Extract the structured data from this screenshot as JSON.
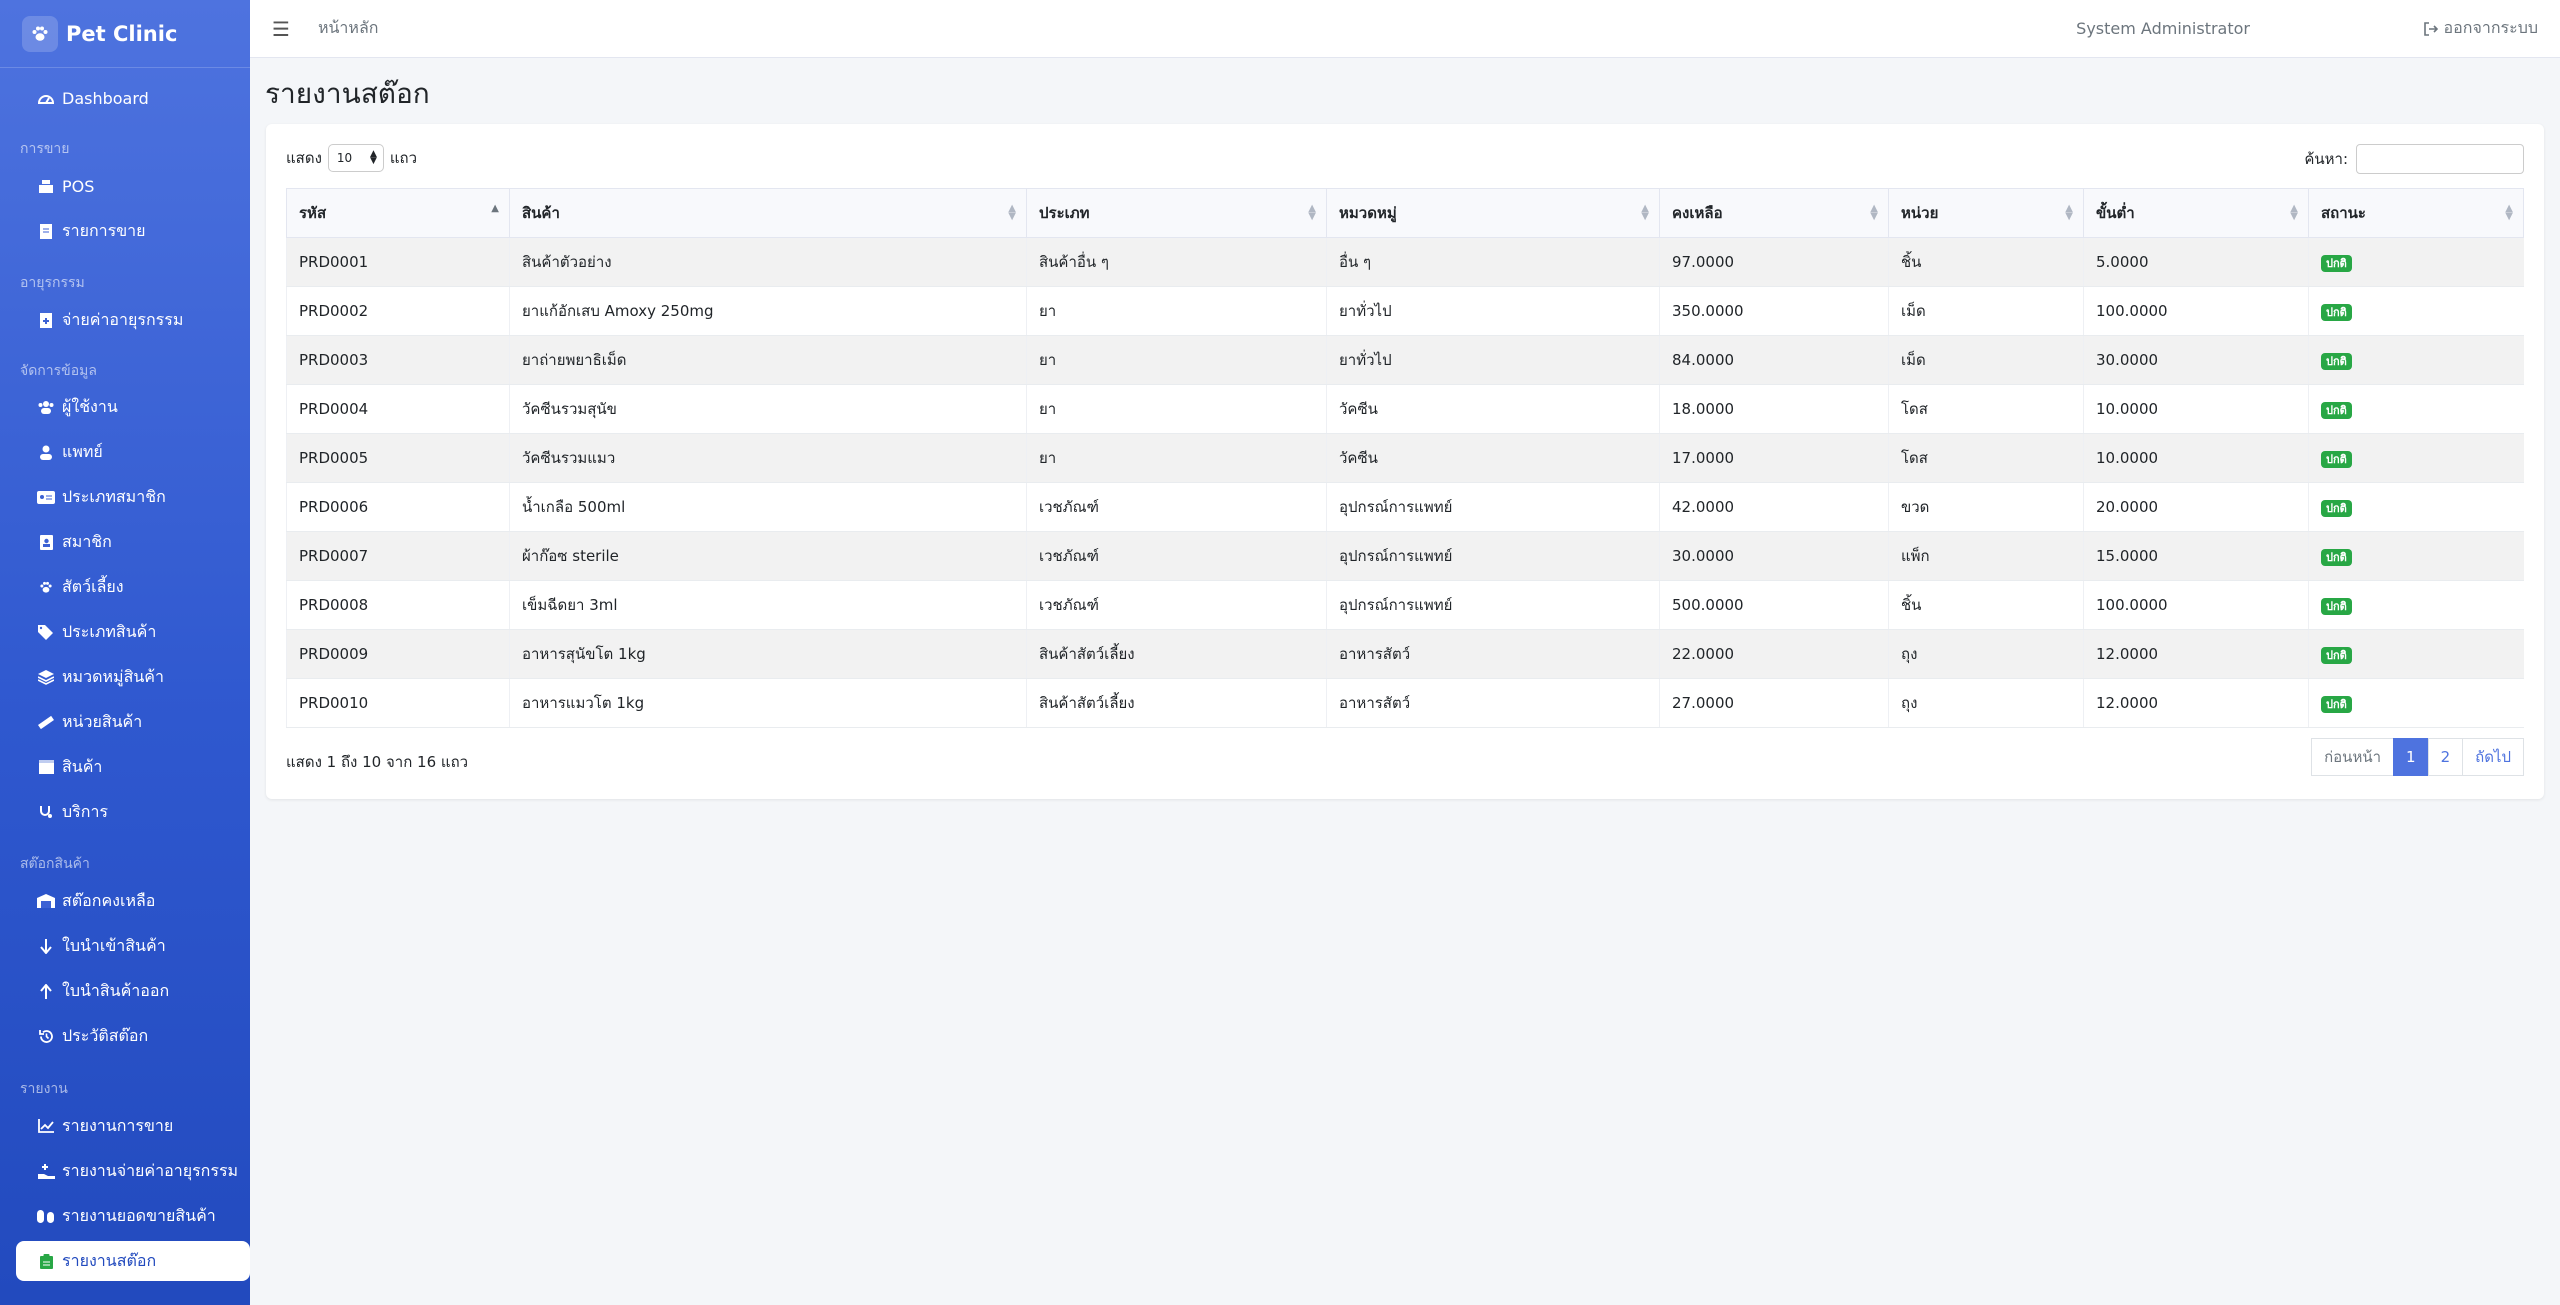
{
  "brand": {
    "name": "Pet Clinic"
  },
  "topbar": {
    "home_label": "หน้าหลัก",
    "user": "System Administrator",
    "logout_label": "ออกจากระบบ"
  },
  "sidebar": {
    "groups": [
      "การขาย",
      "อายุรกรรม",
      "จัดการข้อมูล",
      "สต๊อกสินค้า",
      "รายงาน"
    ],
    "items": [
      {
        "label": "Dashboard",
        "icon": "dashboard-icon"
      },
      {
        "label": "POS",
        "icon": "cash-register-icon"
      },
      {
        "label": "รายการขาย",
        "icon": "receipt-icon"
      },
      {
        "label": "จ่ายค่าอายุรกรรม",
        "icon": "file-medical-icon"
      },
      {
        "label": "ผู้ใช้งาน",
        "icon": "users-icon"
      },
      {
        "label": "แพทย์",
        "icon": "doctor-icon"
      },
      {
        "label": "ประเภทสมาชิก",
        "icon": "id-card-icon"
      },
      {
        "label": "สมาชิก",
        "icon": "address-book-icon"
      },
      {
        "label": "สัตว์เลี้ยง",
        "icon": "paw-icon"
      },
      {
        "label": "ประเภทสินค้า",
        "icon": "tags-icon"
      },
      {
        "label": "หมวดหมู่สินค้า",
        "icon": "layers-icon"
      },
      {
        "label": "หน่วยสินค้า",
        "icon": "ruler-icon"
      },
      {
        "label": "สินค้า",
        "icon": "box-icon"
      },
      {
        "label": "บริการ",
        "icon": "stethoscope-icon"
      },
      {
        "label": "สต๊อกคงเหลือ",
        "icon": "warehouse-icon"
      },
      {
        "label": "ใบนำเข้าสินค้า",
        "icon": "arrow-down-icon"
      },
      {
        "label": "ใบนำสินค้าออก",
        "icon": "arrow-up-icon"
      },
      {
        "label": "ประวัติสต๊อก",
        "icon": "history-icon"
      },
      {
        "label": "รายงานการขาย",
        "icon": "chart-line-icon"
      },
      {
        "label": "รายงานจ่ายค่าอายุรกรรม",
        "icon": "hand-medical-icon"
      },
      {
        "label": "รายงานยอดขายสินค้า",
        "icon": "capsules-icon"
      },
      {
        "label": "รายงานสต๊อก",
        "icon": "clipboard-icon"
      }
    ]
  },
  "page": {
    "title": "รายงานสต๊อก"
  },
  "table_controls": {
    "show_label": "แสดง",
    "page_length": "10",
    "rows_label": "แถว",
    "search_label": "ค้นหา:",
    "search_value": ""
  },
  "columns": [
    "รหัส",
    "สินค้า",
    "ประเภท",
    "หมวดหมู่",
    "คงเหลือ",
    "หน่วย",
    "ขั้นต่ำ",
    "สถานะ"
  ],
  "rows": [
    [
      "PRD0001",
      "สินค้าตัวอย่าง",
      "สินค้าอื่น ๆ",
      "อื่น ๆ",
      "97.0000",
      "ชิ้น",
      "5.0000",
      "ปกติ"
    ],
    [
      "PRD0002",
      "ยาแก้อักเสบ Amoxy 250mg",
      "ยา",
      "ยาทั่วไป",
      "350.0000",
      "เม็ด",
      "100.0000",
      "ปกติ"
    ],
    [
      "PRD0003",
      "ยาถ่ายพยาธิเม็ด",
      "ยา",
      "ยาทั่วไป",
      "84.0000",
      "เม็ด",
      "30.0000",
      "ปกติ"
    ],
    [
      "PRD0004",
      "วัคซีนรวมสุนัข",
      "ยา",
      "วัคซีน",
      "18.0000",
      "โดส",
      "10.0000",
      "ปกติ"
    ],
    [
      "PRD0005",
      "วัคซีนรวมแมว",
      "ยา",
      "วัคซีน",
      "17.0000",
      "โดส",
      "10.0000",
      "ปกติ"
    ],
    [
      "PRD0006",
      "น้ำเกลือ 500ml",
      "เวชภัณฑ์",
      "อุปกรณ์การแพทย์",
      "42.0000",
      "ขวด",
      "20.0000",
      "ปกติ"
    ],
    [
      "PRD0007",
      "ผ้าก๊อซ sterile",
      "เวชภัณฑ์",
      "อุปกรณ์การแพทย์",
      "30.0000",
      "แพ็ก",
      "15.0000",
      "ปกติ"
    ],
    [
      "PRD0008",
      "เข็มฉีดยา 3ml",
      "เวชภัณฑ์",
      "อุปกรณ์การแพทย์",
      "500.0000",
      "ชิ้น",
      "100.0000",
      "ปกติ"
    ],
    [
      "PRD0009",
      "อาหารสุนัขโต 1kg",
      "สินค้าสัตว์เลี้ยง",
      "อาหารสัตว์",
      "22.0000",
      "ถุง",
      "12.0000",
      "ปกติ"
    ],
    [
      "PRD0010",
      "อาหารแมวโต 1kg",
      "สินค้าสัตว์เลี้ยง",
      "อาหารสัตว์",
      "27.0000",
      "ถุง",
      "12.0000",
      "ปกติ"
    ]
  ],
  "footer": {
    "info": "แสดง 1 ถึง 10 จาก 16 แถว",
    "prev": "ก่อนหน้า",
    "pages": [
      "1",
      "2"
    ],
    "next": "ถัดไป"
  },
  "colors": {
    "primary": "#4e73df",
    "sidebar_dark": "#224abe",
    "badge": "#28a745"
  }
}
